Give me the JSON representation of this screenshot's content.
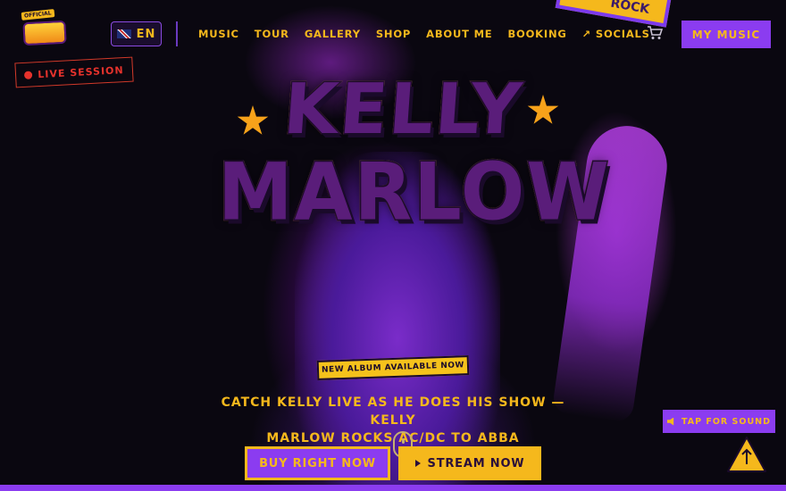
{
  "logo": {
    "badge": "OFFICIAL",
    "name": "Kelly Marlow"
  },
  "sticker": {
    "label": "ROCK"
  },
  "language": {
    "code": "EN"
  },
  "nav": {
    "items": [
      "MUSIC",
      "TOUR",
      "GALLERY",
      "SHOP",
      "ABOUT ME",
      "BOOKING",
      "↗ SOCIALS"
    ]
  },
  "my_music_label": "MY MUSIC",
  "live_session_label": "LIVE SESSION",
  "hero": {
    "title_line1": "Kelly",
    "title_line2": "Marlow",
    "badge": "NEW ALBUM AVAILABLE NOW",
    "tagline_line1": "CATCH KELLY LIVE AS HE DOES HIS SHOW — KELLY",
    "tagline_line2": "MARLOW ROCKS AC/DC TO ABBA",
    "buy_label": "BUY RIGHT NOW",
    "stream_label": "STREAM NOW"
  },
  "sound_label": "TAP FOR SOUND",
  "colors": {
    "accent_purple": "#8b3cf0",
    "accent_yellow": "#f5b81c",
    "live_red": "#e5322c",
    "background": "#0a0710"
  },
  "icons": [
    "uk-flag-icon",
    "cart-icon",
    "play-icon",
    "speaker-icon",
    "arrow-up-icon",
    "mouse-scroll-icon",
    "star-icon"
  ]
}
